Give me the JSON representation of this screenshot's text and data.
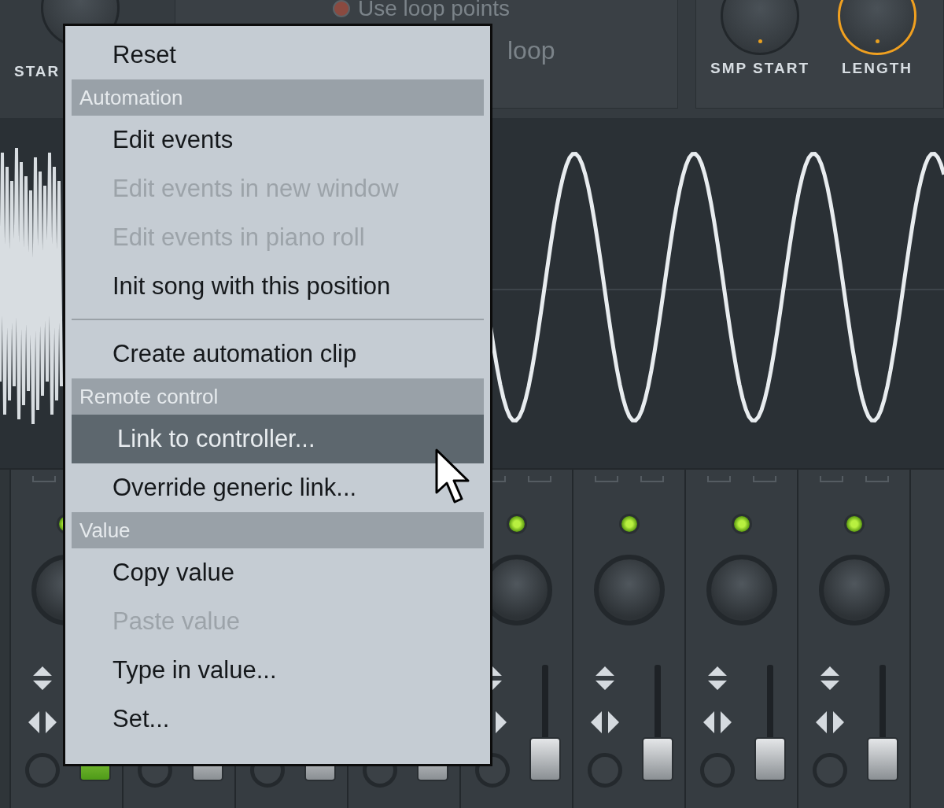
{
  "top_panel": {
    "start_label": "STAR",
    "loop_points_label": "Use loop points",
    "loop_points_on": false,
    "loop_label": "loop",
    "knobs": [
      {
        "label": "SMP START",
        "selected": false
      },
      {
        "label": "LENGTH",
        "selected": true
      }
    ]
  },
  "mixer": {
    "strips": [
      {
        "selected": true
      },
      {
        "selected": false
      },
      {
        "selected": false
      },
      {
        "selected": false
      },
      {
        "selected": false
      },
      {
        "selected": false
      },
      {
        "selected": false
      },
      {
        "selected": false
      }
    ]
  },
  "context_menu": {
    "items": [
      {
        "kind": "item",
        "label": "Reset",
        "disabled": false,
        "selected": false
      },
      {
        "kind": "header",
        "label": "Automation"
      },
      {
        "kind": "item",
        "label": "Edit events",
        "disabled": false,
        "selected": false
      },
      {
        "kind": "item",
        "label": "Edit events in new window",
        "disabled": true,
        "selected": false
      },
      {
        "kind": "item",
        "label": "Edit events in piano roll",
        "disabled": true,
        "selected": false
      },
      {
        "kind": "item",
        "label": "Init song with this position",
        "disabled": false,
        "selected": false
      },
      {
        "kind": "separator"
      },
      {
        "kind": "item",
        "label": "Create automation clip",
        "disabled": false,
        "selected": false
      },
      {
        "kind": "header",
        "label": "Remote control"
      },
      {
        "kind": "item",
        "label": "Link to controller...",
        "disabled": false,
        "selected": true
      },
      {
        "kind": "item",
        "label": "Override generic link...",
        "disabled": false,
        "selected": false
      },
      {
        "kind": "header",
        "label": "Value"
      },
      {
        "kind": "item",
        "label": "Copy value",
        "disabled": false,
        "selected": false
      },
      {
        "kind": "item",
        "label": "Paste value",
        "disabled": true,
        "selected": false
      },
      {
        "kind": "item",
        "label": "Type in value...",
        "disabled": false,
        "selected": false
      },
      {
        "kind": "item",
        "label": "Set...",
        "disabled": false,
        "selected": false
      }
    ]
  }
}
